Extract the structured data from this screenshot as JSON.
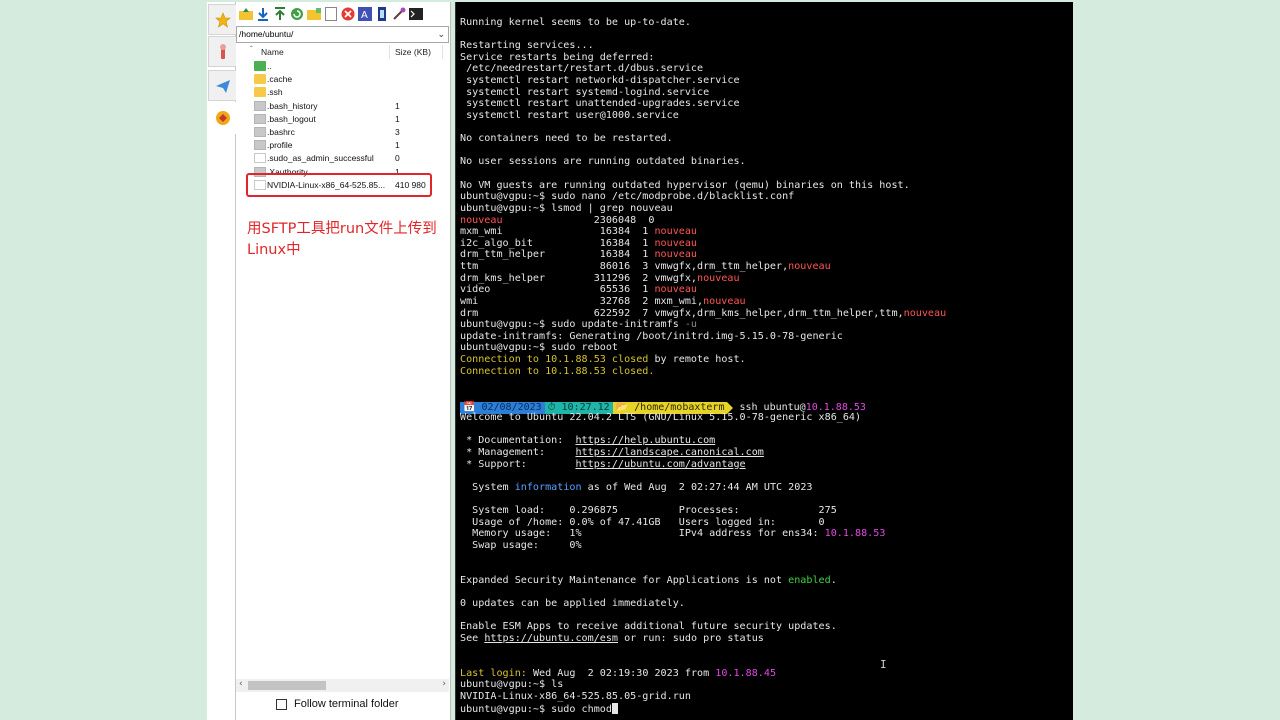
{
  "sidebar_tabs": [
    {
      "name": "favorites-star-icon"
    },
    {
      "name": "tools-icon"
    },
    {
      "name": "send-icon"
    },
    {
      "name": "sftp-icon"
    }
  ],
  "sftp": {
    "path": "/home/ubuntu/",
    "columns": {
      "name": "Name",
      "size": "Size (KB)"
    },
    "files": [
      {
        "name": "..",
        "size": "",
        "type": "up"
      },
      {
        "name": ".cache",
        "size": "",
        "type": "folder"
      },
      {
        "name": ".ssh",
        "size": "",
        "type": "folder"
      },
      {
        "name": ".bash_history",
        "size": "1",
        "type": "file"
      },
      {
        "name": ".bash_logout",
        "size": "1",
        "type": "file"
      },
      {
        "name": ".bashrc",
        "size": "3",
        "type": "file"
      },
      {
        "name": ".profile",
        "size": "1",
        "type": "file"
      },
      {
        "name": ".sudo_as_admin_successful",
        "size": "0",
        "type": "empty"
      },
      {
        "name": ".Xauthority",
        "size": "1",
        "type": "file"
      },
      {
        "name": "NVIDIA-Linux-x86_64-525.85...",
        "size": "410 980",
        "type": "empty"
      }
    ],
    "annotation": "用SFTP工具把run文件上传到Linux中",
    "follow_label": "Follow terminal folder"
  },
  "terminal": {
    "lines": [
      [
        {
          "t": "Running kernel seems to be up-to-date."
        }
      ],
      [],
      [
        {
          "t": "Restarting services..."
        }
      ],
      [
        {
          "t": "Service restarts being deferred:"
        }
      ],
      [
        {
          "t": " /etc/needrestart/restart.d/dbus.service"
        }
      ],
      [
        {
          "t": " systemctl restart networkd-dispatcher.service"
        }
      ],
      [
        {
          "t": " systemctl restart systemd-logind.service"
        }
      ],
      [
        {
          "t": " systemctl restart unattended-upgrades.service"
        }
      ],
      [
        {
          "t": " systemctl restart user@1000.service"
        }
      ],
      [],
      [
        {
          "t": "No containers need to be restarted."
        }
      ],
      [],
      [
        {
          "t": "No user sessions are running outdated binaries."
        }
      ],
      [],
      [
        {
          "t": "No VM guests are running outdated hypervisor (qemu) binaries on this host."
        }
      ],
      [
        {
          "t": "ubuntu@vgpu:~$ sudo nano /etc/modprobe.d/blacklist.conf"
        }
      ],
      [
        {
          "t": "ubuntu@vgpu:~$ lsmod | grep nouveau"
        }
      ],
      [
        {
          "t": "nouveau",
          "c": "red"
        },
        {
          "t": "               2306048  0"
        }
      ],
      [
        {
          "t": "mxm_wmi                16384  1 "
        },
        {
          "t": "nouveau",
          "c": "red"
        }
      ],
      [
        {
          "t": "i2c_algo_bit           16384  1 "
        },
        {
          "t": "nouveau",
          "c": "red"
        }
      ],
      [
        {
          "t": "drm_ttm_helper         16384  1 "
        },
        {
          "t": "nouveau",
          "c": "red"
        }
      ],
      [
        {
          "t": "ttm                    86016  3 vmwgfx,drm_ttm_helper,"
        },
        {
          "t": "nouveau",
          "c": "red"
        }
      ],
      [
        {
          "t": "drm_kms_helper        311296  2 vmwgfx,"
        },
        {
          "t": "nouveau",
          "c": "red"
        }
      ],
      [
        {
          "t": "video                  65536  1 "
        },
        {
          "t": "nouveau",
          "c": "red"
        }
      ],
      [
        {
          "t": "wmi                    32768  2 mxm_wmi,"
        },
        {
          "t": "nouveau",
          "c": "red"
        }
      ],
      [
        {
          "t": "drm                   622592  7 vmwgfx,drm_kms_helper,drm_ttm_helper,ttm,"
        },
        {
          "t": "nouveau",
          "c": "red"
        }
      ],
      [
        {
          "t": "ubuntu@vgpu:~$ sudo update-initramfs "
        },
        {
          "t": "-u",
          "c": "gry"
        }
      ],
      [
        {
          "t": "update-initramfs: Generating /boot/initrd.img-5.15.0-78-generic"
        }
      ],
      [
        {
          "t": "ubuntu@vgpu:~$ sudo reboot"
        }
      ],
      [
        {
          "t": "Connection to 10.1.88.53 closed",
          "c": "yel"
        },
        {
          "t": " by remote host."
        }
      ],
      [
        {
          "t": "Connection to 10.1.88.53 closed.",
          "c": "yel"
        }
      ],
      [],
      [],
      [],
      [
        {
          "t": "Welcome to Ubuntu 22.04.2 LTS (GNU/Linux 5.15.0-78-generic x86_64)"
        }
      ],
      [],
      [
        {
          "t": " * Documentation:  "
        },
        {
          "t": "https://help.ubuntu.com",
          "u": true
        }
      ],
      [
        {
          "t": " * Management:     "
        },
        {
          "t": "https://landscape.canonical.com",
          "u": true
        }
      ],
      [
        {
          "t": " * Support:        "
        },
        {
          "t": "https://ubuntu.com/advantage",
          "u": true
        }
      ],
      [],
      [
        {
          "t": "  System "
        },
        {
          "t": "information",
          "c": "blu"
        },
        {
          "t": " as of Wed Aug  2 02:27:44 AM UTC 2023"
        }
      ],
      [],
      [
        {
          "t": "  System load:    0.296875          Processes:             275"
        }
      ],
      [
        {
          "t": "  Usage of /home: 0.0% of 47.41GB   Users logged in:       0"
        }
      ],
      [
        {
          "t": "  Memory usage:   1%                IPv4 address for ens34: "
        },
        {
          "t": "10.1.88.53",
          "c": "mag"
        }
      ],
      [
        {
          "t": "  Swap usage:     0%"
        }
      ],
      [],
      [],
      [
        {
          "t": "Expanded Security Maintenance for Applications is not "
        },
        {
          "t": "enabled",
          "c": "grn"
        },
        {
          "t": "."
        }
      ],
      [],
      [
        {
          "t": "0 updates can be applied immediately."
        }
      ],
      [],
      [
        {
          "t": "Enable ESM Apps to receive additional future security updates."
        }
      ],
      [
        {
          "t": "See "
        },
        {
          "t": "https://ubuntu.com/esm",
          "u": true
        },
        {
          "t": " or run: sudo pro status"
        }
      ],
      [],
      [],
      [
        {
          "t": "Last login: ",
          "c": "yel"
        },
        {
          "t": "Wed Aug  2 02:19:30 2023 from "
        },
        {
          "t": "10.1.88.45",
          "c": "mag"
        }
      ],
      [
        {
          "t": "ubuntu@vgpu:~$ ls"
        }
      ],
      [
        {
          "t": "NVIDIA-Linux-x86_64-525.85.05-grid.run"
        }
      ],
      [
        {
          "t": "ubuntu@vgpu:~$ sudo chmod",
          "cursor": true
        }
      ]
    ],
    "prompt_bar": {
      "date": "📅 02/08/2023",
      "time": "⏱ 10:27.12",
      "dir": "📂 /home/mobaxterm",
      "cmd": "ssh ubuntu@",
      "host": "10.1.88.53"
    }
  }
}
